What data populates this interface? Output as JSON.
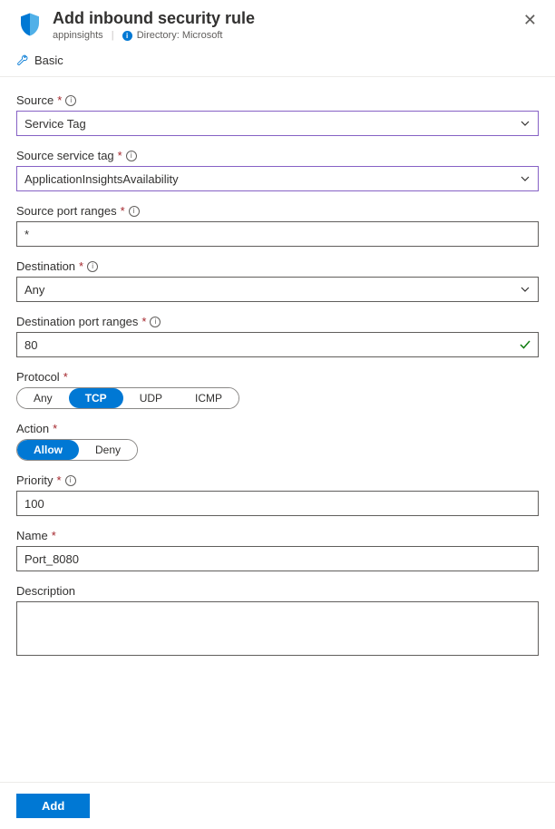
{
  "header": {
    "title": "Add inbound security rule",
    "subtitle_resource": "appinsights",
    "directory_label": "Directory:",
    "directory_value": "Microsoft"
  },
  "toolbar": {
    "basic_label": "Basic"
  },
  "fields": {
    "source": {
      "label": "Source",
      "value": "Service Tag"
    },
    "source_service_tag": {
      "label": "Source service tag",
      "value": "ApplicationInsightsAvailability"
    },
    "source_port_ranges": {
      "label": "Source port ranges",
      "value": "*"
    },
    "destination": {
      "label": "Destination",
      "value": "Any"
    },
    "destination_port_ranges": {
      "label": "Destination port ranges",
      "value": "80"
    },
    "protocol": {
      "label": "Protocol",
      "options": [
        "Any",
        "TCP",
        "UDP",
        "ICMP"
      ],
      "selected": "TCP"
    },
    "action": {
      "label": "Action",
      "options": [
        "Allow",
        "Deny"
      ],
      "selected": "Allow"
    },
    "priority": {
      "label": "Priority",
      "value": "100"
    },
    "name": {
      "label": "Name",
      "value": "Port_8080"
    },
    "description": {
      "label": "Description",
      "value": ""
    }
  },
  "footer": {
    "add_label": "Add"
  }
}
